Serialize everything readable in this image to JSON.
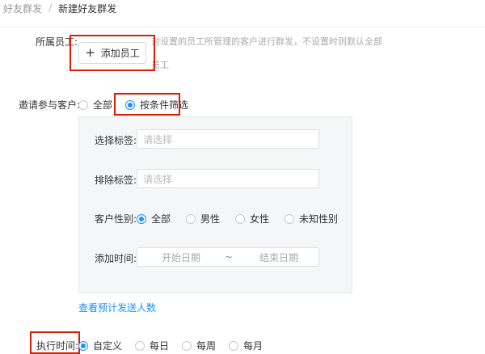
{
  "breadcrumb": {
    "root": "好友群发",
    "separator": "/",
    "current": "新建好友群发"
  },
  "staff": {
    "label": "所属员工:",
    "add_button": "添加员工",
    "hint": "对设置的员工所管理的客户进行群发，不设置时则默认全部",
    "hint_cont": "员工"
  },
  "invite": {
    "label": "邀请参与客户:",
    "options": [
      "全部",
      "按条件筛选"
    ],
    "selected": "按条件筛选"
  },
  "filters": {
    "select_tag": {
      "label": "选择标签:",
      "placeholder": "请选择"
    },
    "exclude_tag": {
      "label": "排除标签:",
      "placeholder": "请选择"
    },
    "gender": {
      "label": "客户性别:",
      "options": [
        "全部",
        "男性",
        "女性",
        "未知性别"
      ],
      "selected": "全部"
    },
    "added_time": {
      "label": "添加时间:",
      "start_placeholder": "开始日期",
      "separator": "~",
      "end_placeholder": "结束日期"
    }
  },
  "preview_link": "查看预计发送人数",
  "exec_time": {
    "label": "执行时间:",
    "options": [
      "自定义",
      "每日",
      "每周",
      "每月"
    ],
    "selected": "自定义"
  },
  "colors": {
    "accent": "#1890ff",
    "highlight_box": "#d81e06"
  }
}
